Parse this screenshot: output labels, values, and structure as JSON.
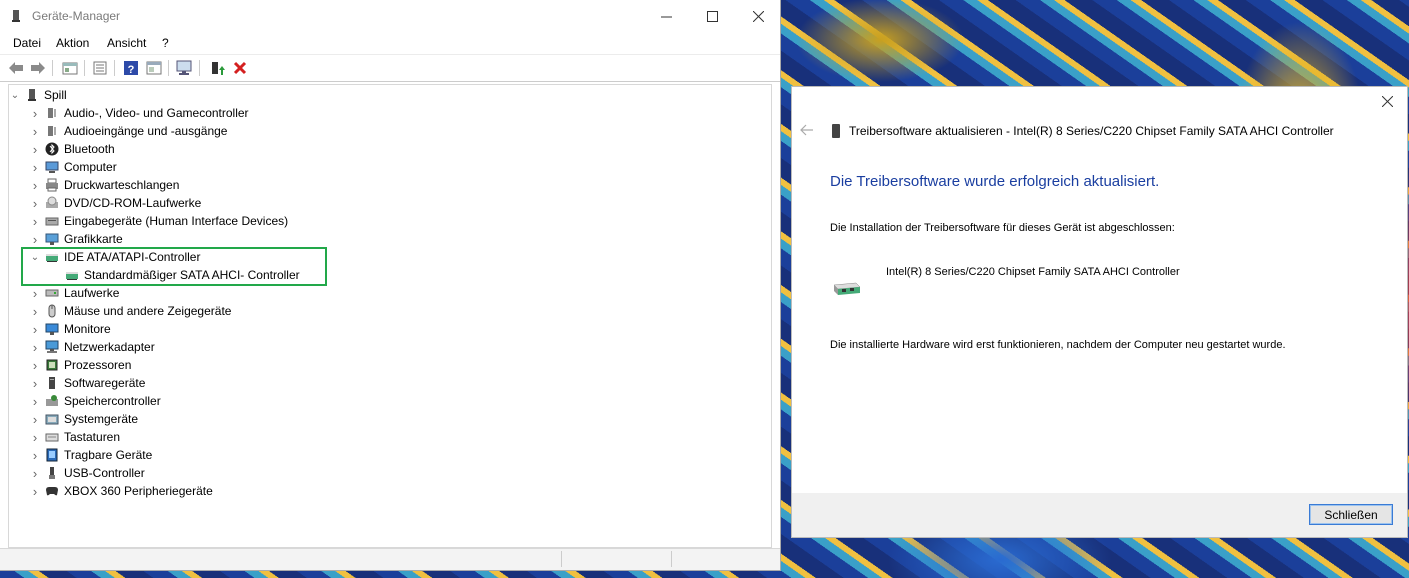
{
  "device_manager": {
    "title": "Geräte-Manager",
    "menu": [
      "Datei",
      "Aktion",
      "Ansicht",
      "?"
    ],
    "toolbar_icons": [
      "back-arrow-icon",
      "forward-arrow-icon",
      "view-icon",
      "properties-icon",
      "help-icon",
      "console-icon",
      "monitor-scan-icon",
      "update-driver-icon",
      "uninstall-icon"
    ],
    "tree": {
      "root": "Spill",
      "categories": [
        {
          "label": "Audio-, Video- und Gamecontroller",
          "icon": "speaker-icon"
        },
        {
          "label": "Audioeingänge und -ausgänge",
          "icon": "speaker-icon"
        },
        {
          "label": "Bluetooth",
          "icon": "bluetooth-icon"
        },
        {
          "label": "Computer",
          "icon": "computer-icon"
        },
        {
          "label": "Druckwarteschlangen",
          "icon": "printer-icon"
        },
        {
          "label": "DVD/CD-ROM-Laufwerke",
          "icon": "disc-icon"
        },
        {
          "label": "Eingabegeräte (Human Interface Devices)",
          "icon": "hid-icon"
        },
        {
          "label": "Grafikkarte",
          "icon": "display-adapter-icon"
        },
        {
          "label": "IDE ATA/ATAPI-Controller",
          "icon": "controller-icon",
          "expanded": true
        },
        {
          "label": "Laufwerke",
          "icon": "drive-icon"
        },
        {
          "label": "Mäuse und andere Zeigegeräte",
          "icon": "mouse-icon"
        },
        {
          "label": "Monitore",
          "icon": "monitor-icon"
        },
        {
          "label": "Netzwerkadapter",
          "icon": "network-icon"
        },
        {
          "label": "Prozessoren",
          "icon": "processor-icon"
        },
        {
          "label": "Softwaregeräte",
          "icon": "software-device-icon"
        },
        {
          "label": "Speichercontroller",
          "icon": "storage-icon"
        },
        {
          "label": "Systemgeräte",
          "icon": "system-icon"
        },
        {
          "label": "Tastaturen",
          "icon": "keyboard-icon"
        },
        {
          "label": "Tragbare Geräte",
          "icon": "portable-device-icon"
        },
        {
          "label": "USB-Controller",
          "icon": "usb-icon"
        },
        {
          "label": "XBOX 360 Peripheriegeräte",
          "icon": "gamepad-icon"
        }
      ],
      "child_of_ide": "Standardmäßiger SATA AHCI- Controller"
    }
  },
  "dialog": {
    "header": "Treibersoftware aktualisieren - Intel(R) 8 Series/C220 Chipset Family SATA AHCI Controller",
    "heading": "Die Treibersoftware wurde erfolgreich aktualisiert.",
    "text1": "Die Installation der Treibersoftware für dieses Gerät ist abgeschlossen:",
    "hardware_name": "Intel(R) 8 Series/C220 Chipset Family SATA AHCI Controller",
    "text2": "Die installierte Hardware wird erst funktionieren, nachdem der Computer neu gestartet wurde.",
    "close_button": "Schließen"
  },
  "colors": {
    "heading_blue": "#1a3ea0",
    "highlight_green": "#22a84a",
    "uninstall_red": "#d42020"
  }
}
